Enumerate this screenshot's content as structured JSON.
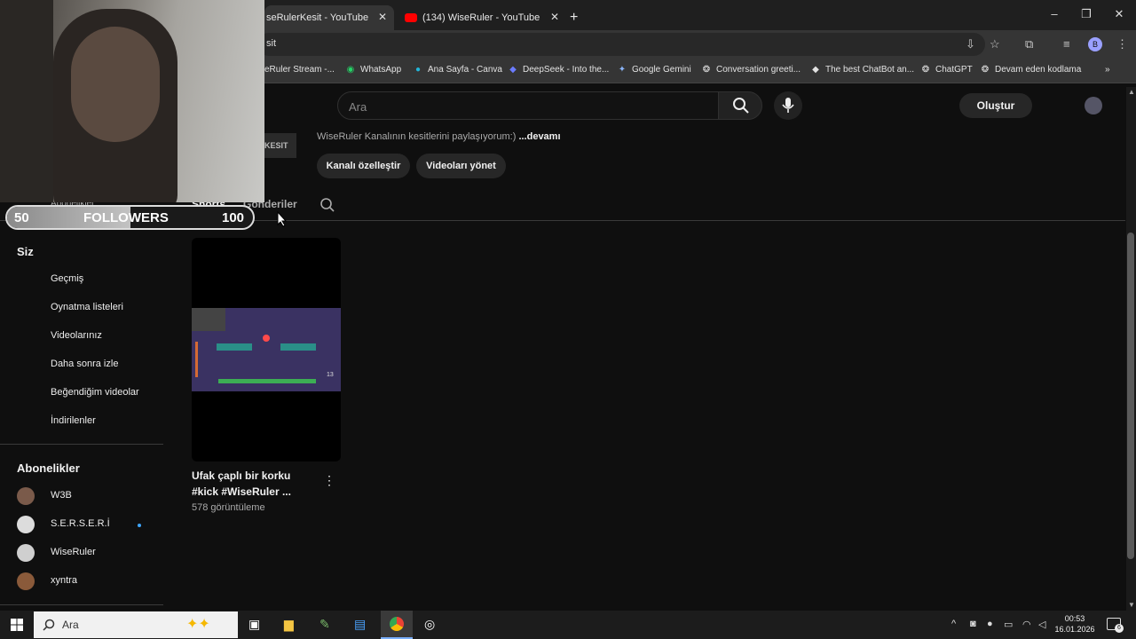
{
  "browser": {
    "tabs": [
      {
        "title": "seRulerKesit - YouTube",
        "active": true
      },
      {
        "title": "(134) WiseRuler - YouTube",
        "active": false
      }
    ],
    "new_tab": "+",
    "address": "sit",
    "profile_initial": "B",
    "bookmarks": [
      {
        "label": "eRuler Stream -...",
        "icon": "link-icon"
      },
      {
        "label": "WhatsApp",
        "icon": "whatsapp-icon"
      },
      {
        "label": "Ana Sayfa - Canva",
        "icon": "canva-icon"
      },
      {
        "label": "DeepSeek - Into the...",
        "icon": "deepseek-icon"
      },
      {
        "label": "Google Gemini",
        "icon": "gemini-icon"
      },
      {
        "label": "Conversation greeti...",
        "icon": "chatgpt-icon"
      },
      {
        "label": "The best ChatBot an...",
        "icon": "chatbot-icon"
      },
      {
        "label": "ChatGPT",
        "icon": "chatgpt-icon"
      },
      {
        "label": "Devam eden kodlama",
        "icon": "chatgpt-icon"
      }
    ]
  },
  "youtube": {
    "search_placeholder": "Ara",
    "create_label": "Oluştur",
    "channel_banner_text": "KESIT",
    "channel_description": "WiseRuler Kanalının kesitlerini paylaşıyorum:)",
    "more_label": "...devamı",
    "customize_button": "Kanalı özelleştir",
    "manage_button": "Videoları yönet",
    "channel_tabs": [
      "Shorts",
      "Gönderiler"
    ],
    "sidebar": {
      "partial_item": "Abonelikler",
      "you_heading": "Siz",
      "you_items": [
        "Geçmiş",
        "Oynatma listeleri",
        "Videolarınız",
        "Daha sonra izle",
        "Beğendiğim videolar",
        "İndirilenler"
      ],
      "subs_heading": "Abonelikler",
      "subs": [
        {
          "name": "W3B",
          "color": "#7a5a4a"
        },
        {
          "name": "S.E.R.S.E.R.İ",
          "color": "#dcdcdc"
        },
        {
          "name": "WiseRuler",
          "color": "#cfcfcf"
        },
        {
          "name": "xyntra",
          "color": "#8a5a3a"
        }
      ]
    },
    "video": {
      "title_line1": "Ufak çaplı bir korku",
      "title_line2": "#kick #WiseRuler ...",
      "views": "578 görüntüleme",
      "timer": "13"
    }
  },
  "overlay": {
    "followers_label": "FOLLOWERS",
    "followers_current": "50",
    "followers_goal": "100",
    "followers_progress": 0.5
  },
  "taskbar": {
    "search_placeholder": "Ara",
    "time": "00:53",
    "date": "16.01.2026",
    "notifications": "6"
  },
  "colors": {
    "youtube_bg": "#0f0f0f",
    "youtube_red": "#ff0000",
    "accent_blue": "#3ea6ff"
  }
}
